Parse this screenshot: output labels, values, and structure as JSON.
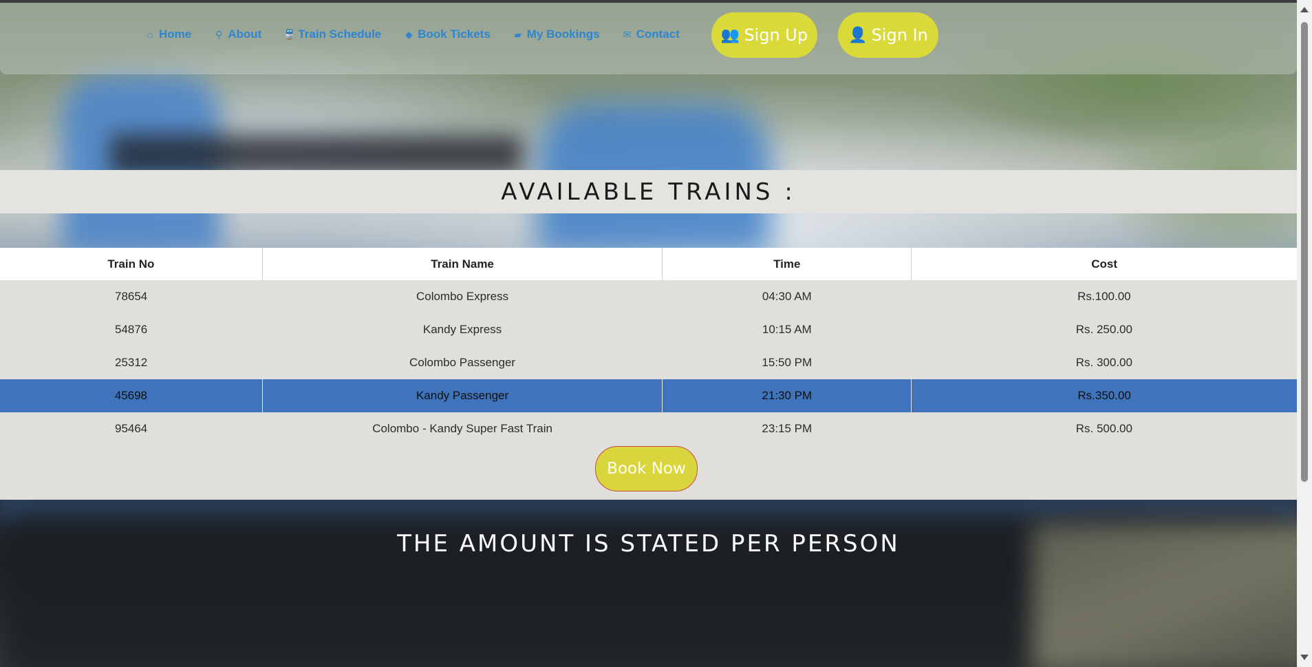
{
  "nav": {
    "links": [
      {
        "label": "Home",
        "icon": "home-icon",
        "glyph": "⌂"
      },
      {
        "label": "About",
        "icon": "search-icon",
        "glyph": "⚲"
      },
      {
        "label": "Train Schedule",
        "icon": "train-icon",
        "glyph": "🚆"
      },
      {
        "label": "Book Tickets",
        "icon": "ticket-icon",
        "glyph": "◆"
      },
      {
        "label": "My Bookings",
        "icon": "book-icon",
        "glyph": "▰"
      },
      {
        "label": "Contact",
        "icon": "envelope-icon",
        "glyph": "✉"
      }
    ],
    "signup": {
      "label": "Sign Up",
      "icon": "users-icon",
      "glyph": "👥"
    },
    "signin": {
      "label": "Sign In",
      "icon": "user-icon",
      "glyph": "👤"
    }
  },
  "title": "AVAILABLE TRAINS :",
  "table": {
    "headers": [
      "Train No",
      "Train Name",
      "Time",
      "Cost"
    ],
    "rows": [
      [
        "78654",
        "Colombo Express",
        "04:30 AM",
        "Rs.100.00"
      ],
      [
        "54876",
        "Kandy Express",
        "10:15 AM",
        "Rs. 250.00"
      ],
      [
        "25312",
        "Colombo Passenger",
        "15:50 PM",
        "Rs. 300.00"
      ],
      [
        "45698",
        "Kandy Passenger",
        "21:30 PM",
        "Rs.350.00"
      ],
      [
        "95464",
        "Colombo - Kandy Super Fast Train",
        "23:15 PM",
        "Rs. 500.00"
      ]
    ],
    "selected_row": 3
  },
  "book_button": "Book Now",
  "notice": "THE AMOUNT IS STATED PER PERSON",
  "colors": {
    "nav_link": "#2f86cf",
    "button": "#d9d93a",
    "selected_row": "#3f74bd",
    "band": "#e4e3e0"
  }
}
